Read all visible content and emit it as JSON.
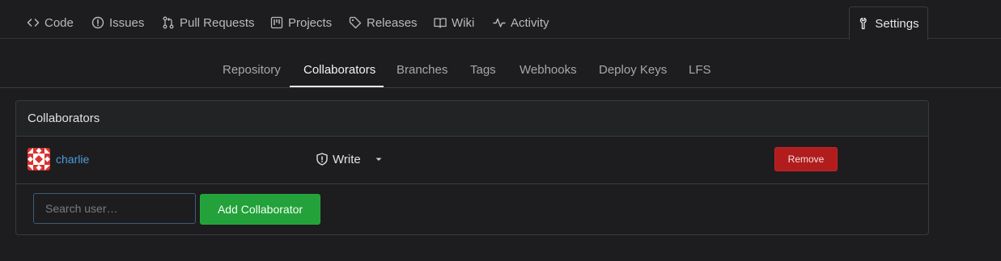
{
  "repo_tabs": [
    {
      "label": "Code",
      "icon": "code-icon"
    },
    {
      "label": "Issues",
      "icon": "issue-icon"
    },
    {
      "label": "Pull Requests",
      "icon": "pull-request-icon"
    },
    {
      "label": "Projects",
      "icon": "project-icon"
    },
    {
      "label": "Releases",
      "icon": "tag-icon"
    },
    {
      "label": "Wiki",
      "icon": "book-icon"
    },
    {
      "label": "Activity",
      "icon": "pulse-icon"
    },
    {
      "label": "Settings",
      "icon": "tool-icon"
    }
  ],
  "settings_nav": {
    "items": [
      "Repository",
      "Collaborators",
      "Branches",
      "Tags",
      "Webhooks",
      "Deploy Keys",
      "LFS"
    ],
    "active": "Collaborators"
  },
  "collaborators": {
    "header": "Collaborators",
    "rows": [
      {
        "username": "charlie",
        "permission": "Write",
        "remove_label": "Remove"
      }
    ],
    "search_placeholder": "Search user…",
    "add_label": "Add Collaborator"
  },
  "colors": {
    "accent_green": "#23a13a",
    "danger_red": "#b11c1c",
    "link_blue": "#4f9bd9"
  }
}
